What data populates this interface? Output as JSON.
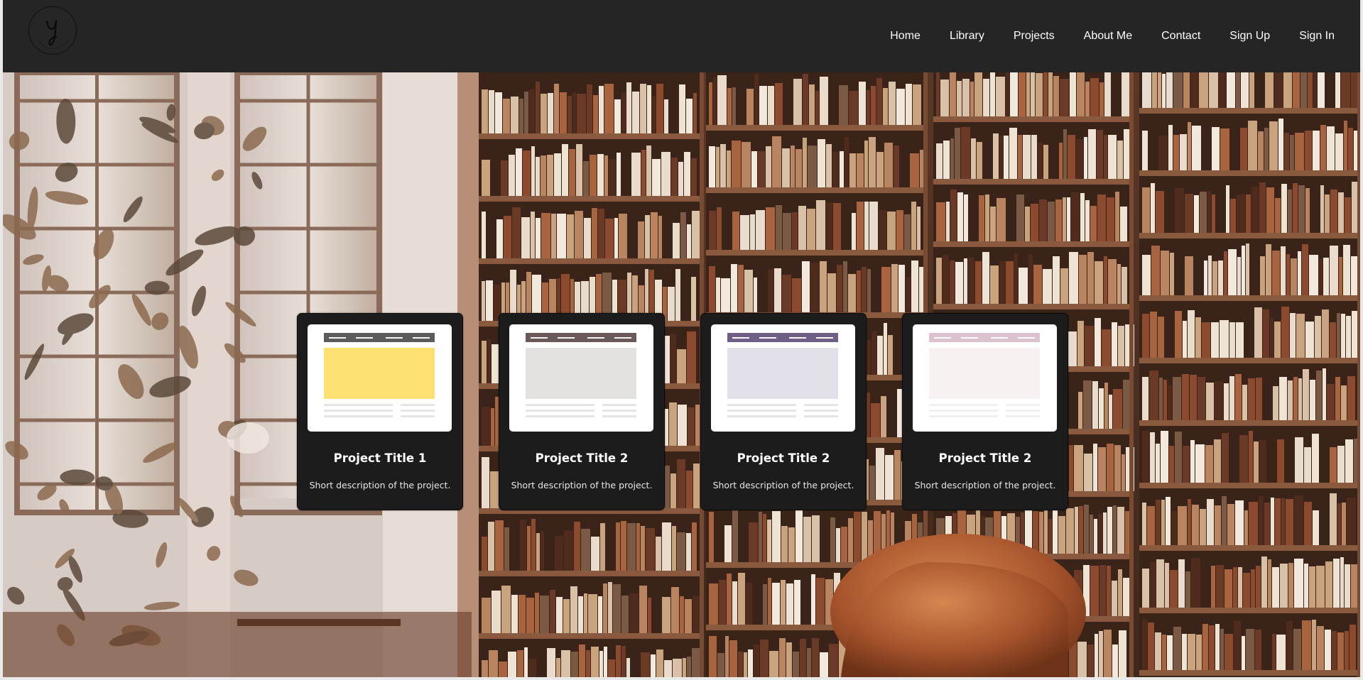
{
  "nav": {
    "logo_icon": "y-signature-logo",
    "items": [
      {
        "label": "Home"
      },
      {
        "label": "Library"
      },
      {
        "label": "Projects"
      },
      {
        "label": "About Me"
      },
      {
        "label": "Contact"
      },
      {
        "label": "Sign Up"
      },
      {
        "label": "Sign In"
      }
    ]
  },
  "hero": {
    "background": "library-bookshelves-photo",
    "colors": {
      "nav_bg": "#252525",
      "card_bg": "#1c1c1c"
    }
  },
  "projects": [
    {
      "title": "Project Title 1",
      "description": "Short description of the project.",
      "bar_color": "#5b5b5b",
      "block_color": "#ffe171",
      "line_color": "#e4e4e4"
    },
    {
      "title": "Project Title 2",
      "description": "Short description of the project.",
      "bar_color": "#6b5959",
      "block_color": "#e4e0e0",
      "line_color": "#e4e4e4"
    },
    {
      "title": "Project Title 2",
      "description": "Short description of the project.",
      "bar_color": "#6f5e86",
      "block_color": "#e2e1ea",
      "line_color": "#e4e4e4"
    },
    {
      "title": "Project Title 2",
      "description": "Short description of the project.",
      "bar_color": "#dcc2cf",
      "block_color": "#f7f1f2",
      "line_color": "#f0f0f0"
    }
  ]
}
